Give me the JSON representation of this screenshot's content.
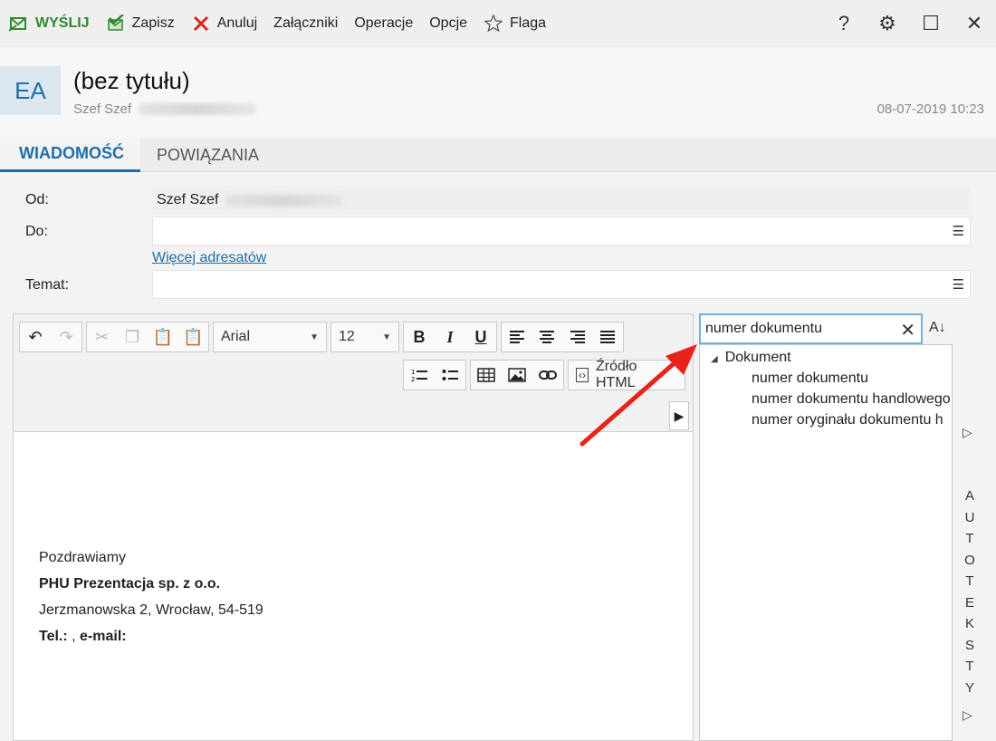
{
  "toolbar": {
    "send": "WYŚLIJ",
    "save": "Zapisz",
    "cancel": "Anuluj",
    "attachments": "Załączniki",
    "operations": "Operacje",
    "options": "Opcje",
    "flag": "Flaga"
  },
  "window_buttons": {
    "help": "?",
    "settings": "⚙",
    "maximize": "☐",
    "close": "✕"
  },
  "header": {
    "avatar_initials": "EA",
    "title": "(bez tytułu)",
    "sender": "Szef Szef",
    "date": "08-07-2019 10:23"
  },
  "tabs": [
    {
      "label": "WIADOMOŚĆ",
      "active": true
    },
    {
      "label": "POWIĄZANIA",
      "active": false
    }
  ],
  "form": {
    "from_label": "Od:",
    "from_value": "Szef Szef",
    "to_label": "Do:",
    "to_value": "",
    "more_recipients": "Więcej adresatów",
    "subject_label": "Temat:",
    "subject_value": ""
  },
  "editor": {
    "font": "Arial",
    "size": "12",
    "source_html": "Źródło HTML",
    "body": {
      "line1": "Pozdrawiamy",
      "line2": "PHU Prezentacja sp. z o.o.",
      "line3": "Jerzmanowska 2, Wrocław, 54-519",
      "line4_bold1": "Tel.:",
      "line4_mid": " , ",
      "line4_bold2": "e-mail:"
    }
  },
  "panel": {
    "search_value": "numer dokumentu",
    "sort_label": "A↓",
    "tree_root": "Dokument",
    "tree_items": [
      "numer dokumentu",
      "numer dokumentu handlowego",
      "numer oryginału dokumentu h"
    ],
    "side_label": "AUTOTEKSTY"
  },
  "colors": {
    "accent": "#1e6fa8",
    "send_green": "#2d8a2d",
    "cancel_red": "#d9251c",
    "annotation_red": "#e8231b"
  }
}
